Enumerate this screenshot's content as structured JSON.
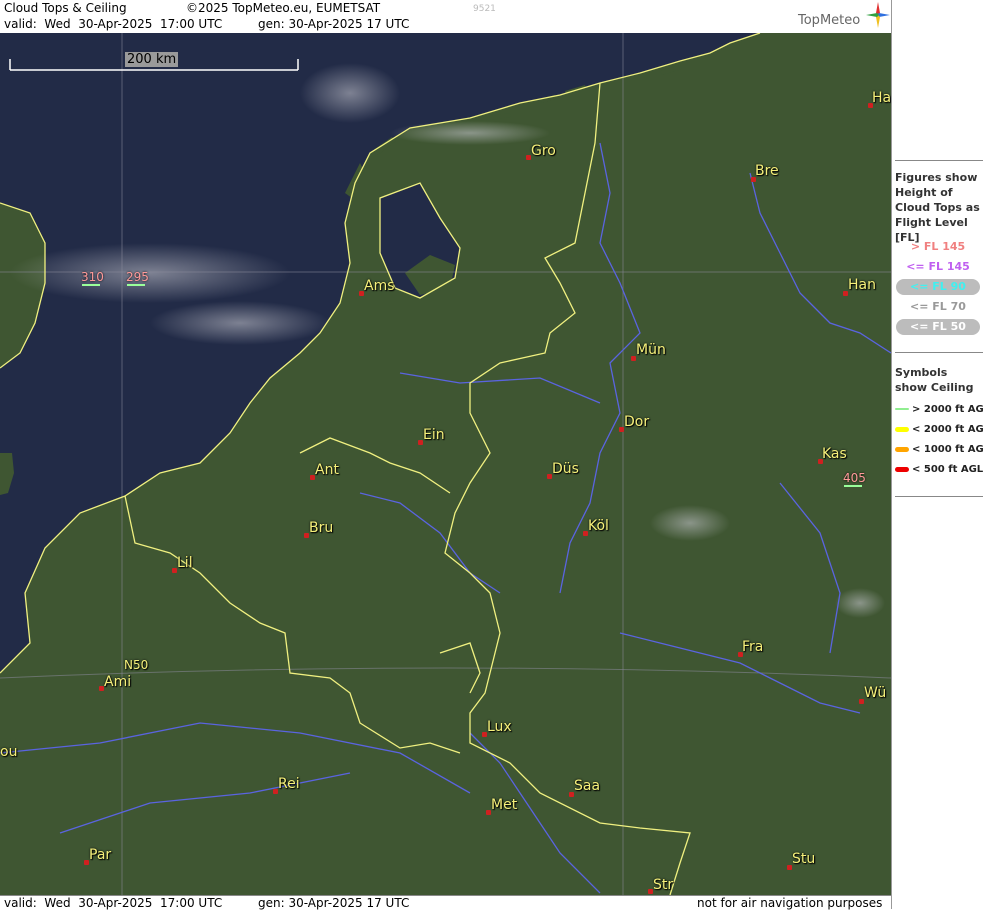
{
  "header": {
    "title": "Cloud Tops & Ceiling",
    "copyright": "©2025 TopMeteo.eu, EUMETSAT",
    "code": "9521",
    "valid": "valid:  Wed  30-Apr-2025  17:00 UTC",
    "generated": "gen: 30-Apr-2025 17 UTC",
    "logo": "TopMeteo"
  },
  "footer": {
    "valid": "valid:  Wed  30-Apr-2025  17:00 UTC",
    "generated": "gen: 30-Apr-2025 17 UTC",
    "disclaimer": "not for air navigation purposes"
  },
  "scale_bar": {
    "label": "200 km"
  },
  "grid_label": "N50",
  "cities": [
    "Gro",
    "Bre",
    "Ha",
    "Ams",
    "Han",
    "Mün",
    "Ein",
    "Dor",
    "Ant",
    "Düs",
    "Kas",
    "Bru",
    "Köl",
    "Lil",
    "Ami",
    "Fra",
    "Wü",
    "Lux",
    "ou",
    "Rei",
    "Saa",
    "Met",
    "Par",
    "Stu",
    "Str"
  ],
  "flight_level_labels": [
    {
      "value": "310",
      "color": "#ff9a9a"
    },
    {
      "value": "295",
      "color": "#ff9a9a"
    },
    {
      "value": "405",
      "color": "#ff9a9a"
    }
  ],
  "legend": {
    "tops_title": "Figures show Height of Cloud Tops as Flight Level  [FL]",
    "levels": [
      {
        "label": "> FL 145",
        "color": "#f08080"
      },
      {
        "label": "<= FL 145",
        "color": "#c060f0"
      },
      {
        "label": "<= FL 90",
        "color": "#40f0f0"
      },
      {
        "label": "<= FL 70",
        "color": "#999999"
      },
      {
        "label": "<= FL 50",
        "color": "#ffffff"
      }
    ],
    "ceiling_title": "Symbols show Ceiling",
    "symbols": [
      {
        "label": "> 2000 ft AGL",
        "color": "#90ee90"
      },
      {
        "label": "< 2000 ft AGL",
        "color": "#ffff00"
      },
      {
        "label": "< 1000 ft AGL",
        "color": "#ffa500"
      },
      {
        "label": "< 500 ft AGL",
        "color": "#ee0000"
      }
    ]
  },
  "colors": {
    "sea": "#1f2846",
    "land": "#3d5530",
    "borders": "#f0f080",
    "rivers": "#5a64e0"
  }
}
